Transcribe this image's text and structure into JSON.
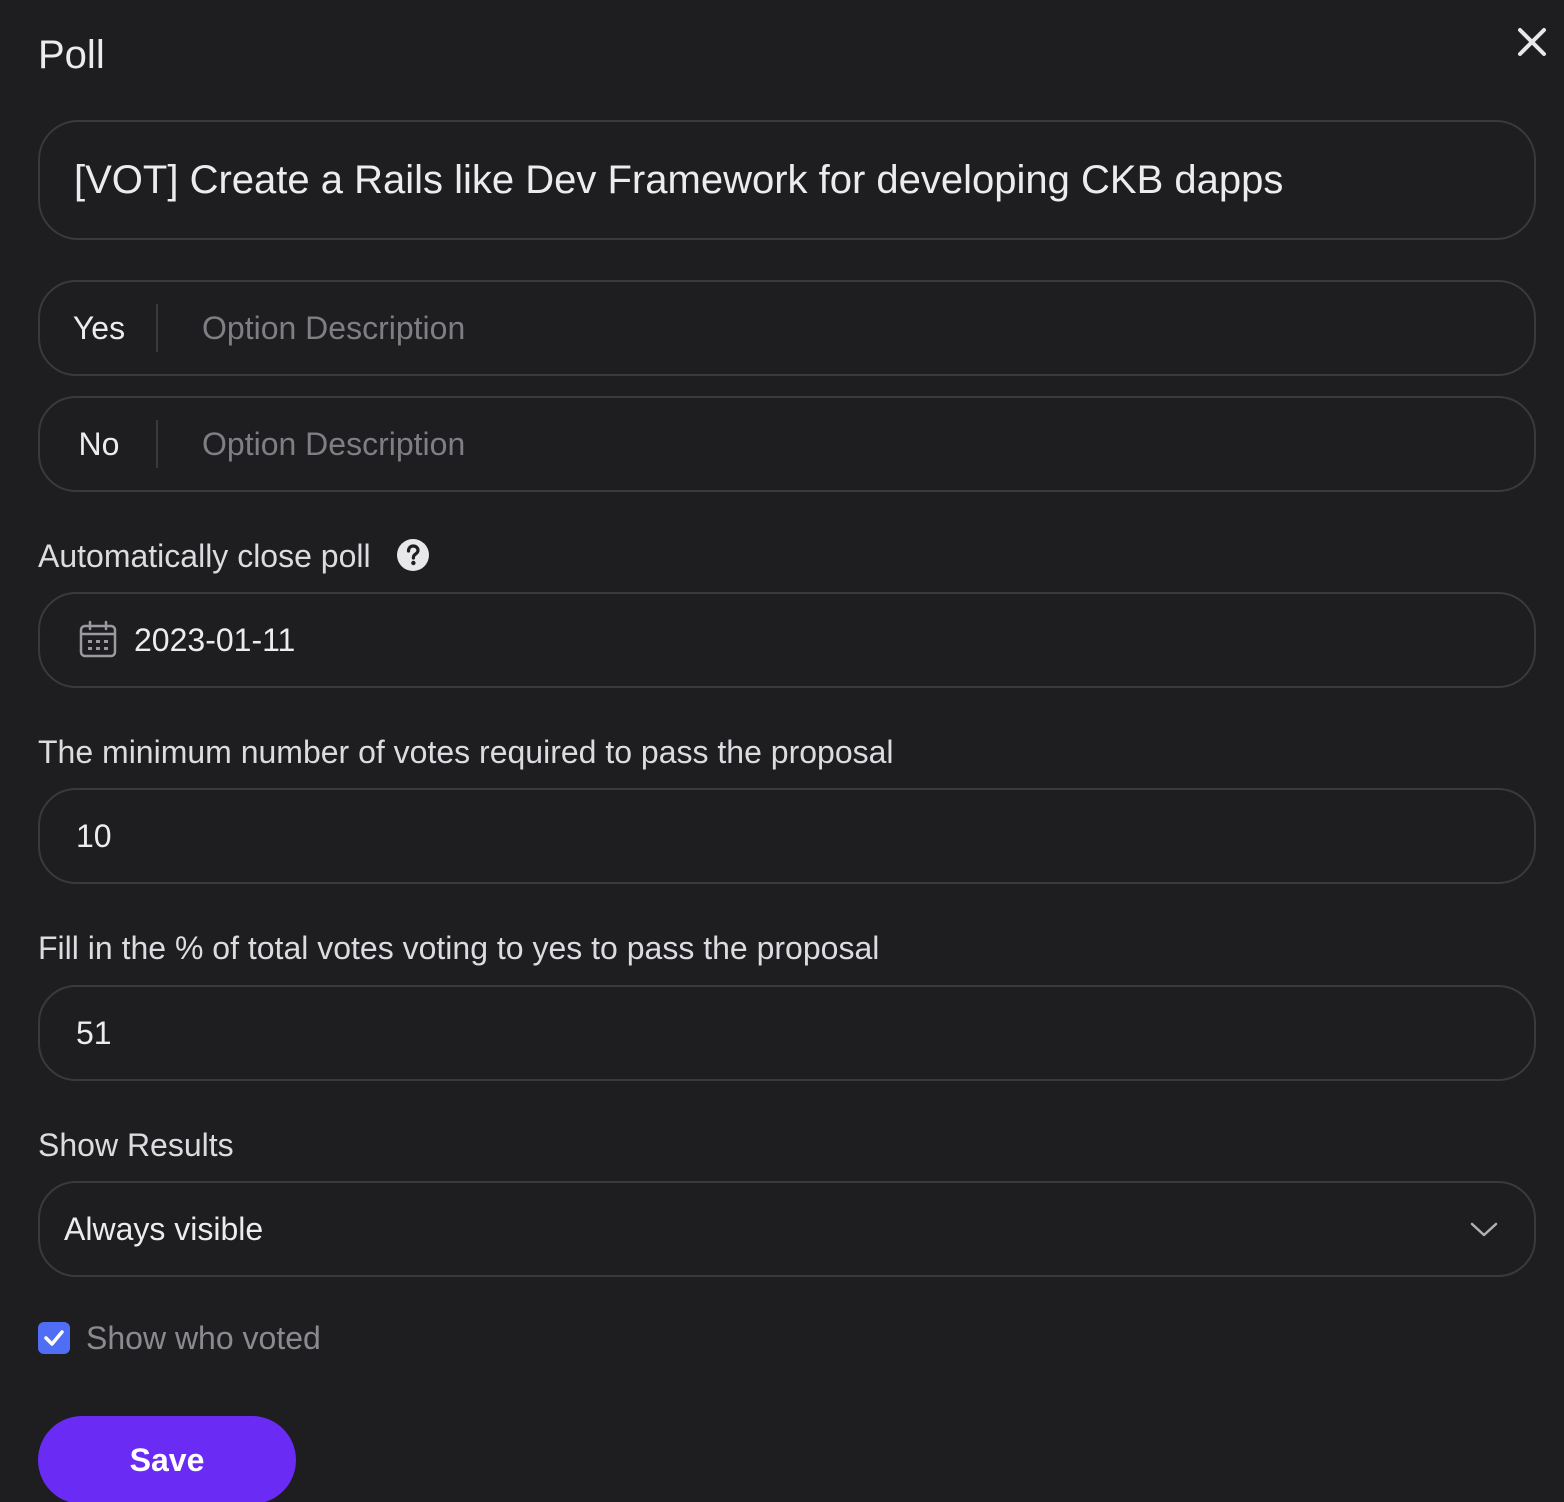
{
  "dialog": {
    "title": "Poll",
    "close_icon": "close-icon"
  },
  "question": {
    "value": "[VOT] Create a Rails like Dev Framework for developing CKB dapps"
  },
  "options": [
    {
      "label": "Yes",
      "placeholder": "Option Description"
    },
    {
      "label": "No",
      "placeholder": "Option Description"
    }
  ],
  "auto_close": {
    "label": "Automatically close poll",
    "help_icon": "help-circle-icon",
    "calendar_icon": "calendar-icon",
    "value": "2023-01-11"
  },
  "min_votes": {
    "label": "The minimum number of votes required to pass the proposal",
    "value": "10"
  },
  "pass_percent": {
    "label": "Fill in the % of total votes voting to yes to pass the proposal",
    "value": "51"
  },
  "show_results": {
    "label": "Show Results",
    "selected": "Always visible",
    "chevron_icon": "chevron-down-icon"
  },
  "show_who_voted": {
    "label": "Show who voted",
    "checked": true
  },
  "save_button": {
    "label": "Save"
  },
  "colors": {
    "background": "#1e1e20",
    "border": "#3a3a3e",
    "accent": "#6a2bf5",
    "checkbox": "#4f6df5"
  }
}
